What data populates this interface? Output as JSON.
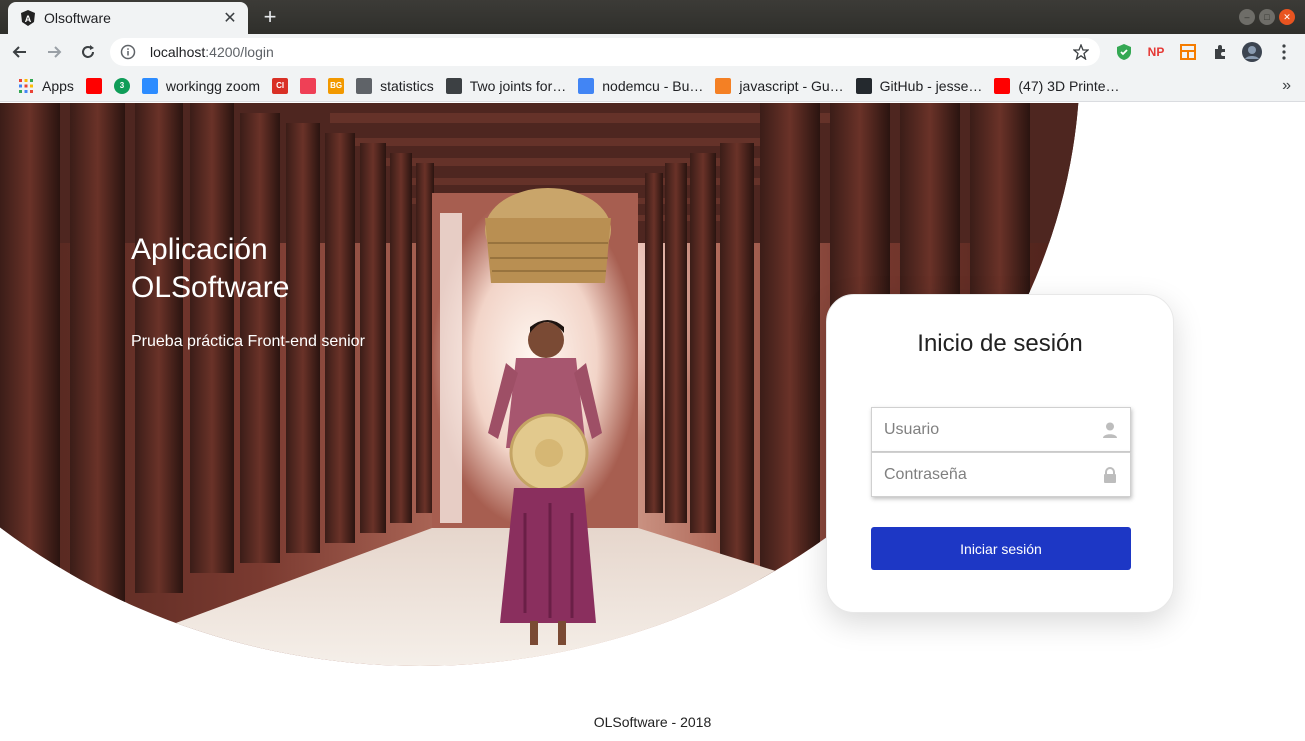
{
  "browser": {
    "tab_title": "Olsoftware",
    "url_host": "localhost",
    "url_path": ":4200/login",
    "window_controls": [
      "minimize",
      "maximize",
      "close"
    ]
  },
  "bookmarks": {
    "apps_label": "Apps",
    "items": [
      {
        "label": "",
        "icon": "youtube-icon",
        "color": "#ff0000"
      },
      {
        "label": "",
        "icon": "badge-3-icon",
        "color": "#0f9d58",
        "badge": "3"
      },
      {
        "label": "workingg zoom",
        "icon": "zoom-icon",
        "color": "#2d8cff"
      },
      {
        "label": "",
        "icon": "ci-icon",
        "color": "#d93025",
        "badge": "CI"
      },
      {
        "label": "",
        "icon": "pocket-icon",
        "color": "#ef4056"
      },
      {
        "label": "",
        "icon": "bg-icon",
        "color": "#f29900",
        "badge": "BG"
      },
      {
        "label": "statistics",
        "icon": "calculator-icon",
        "color": "#5f6368"
      },
      {
        "label": "Two joints for…",
        "icon": "grid-dots-icon",
        "color": "#3c4043"
      },
      {
        "label": "nodemcu - Bu…",
        "icon": "google-icon",
        "color": "#4285f4"
      },
      {
        "label": "javascript - Gu…",
        "icon": "stackoverflow-icon",
        "color": "#f48024"
      },
      {
        "label": "GitHub - jesse…",
        "icon": "github-icon",
        "color": "#24292e"
      },
      {
        "label": "(47) 3D Printe…",
        "icon": "youtube-icon",
        "color": "#ff0000"
      }
    ],
    "more_label": "»"
  },
  "hero": {
    "title": "Aplicación OLSoftware",
    "subtitle": "Prueba práctica Front-end senior"
  },
  "login": {
    "title": "Inicio de sesión",
    "username_placeholder": "Usuario",
    "password_placeholder": "Contraseña",
    "button_label": "Iniciar sesión"
  },
  "footer": {
    "text": "OLSoftware - 2018"
  },
  "colors": {
    "primary_button": "#1d37c5"
  }
}
